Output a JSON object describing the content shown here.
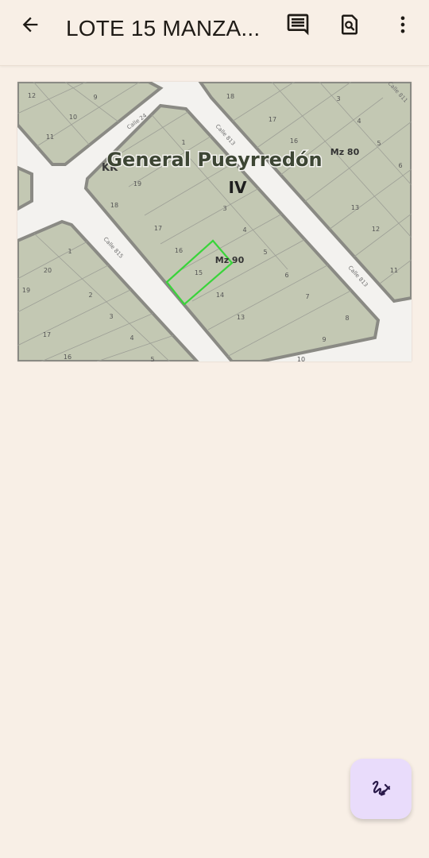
{
  "appbar": {
    "title": "LOTE 15 MANZA...",
    "back_icon": "arrow-back-icon",
    "comment_icon": "comment-icon",
    "find_icon": "find-in-page-icon",
    "more_icon": "more-vert-icon"
  },
  "map": {
    "locality": "General Pueyrredón",
    "section": "IV",
    "block_code": "KK",
    "manzanas": {
      "main": "Mz 90",
      "north": "Mz 80"
    },
    "highlight_color": "#39d43a",
    "streets": [
      "Calle 24",
      "Calle 813",
      "Calle 815",
      "Calle 813",
      "Calle 811"
    ],
    "plots_mz90": [
      "1",
      "19",
      "18",
      "17",
      "16",
      "15",
      "14",
      "13",
      "3",
      "4",
      "5",
      "6",
      "7",
      "8",
      "9",
      "10"
    ],
    "plots_mz80": [
      "18",
      "17",
      "16",
      "3",
      "4",
      "5",
      "6",
      "13",
      "12",
      "11"
    ],
    "plots_left_top": [
      "12",
      "9",
      "10",
      "11"
    ],
    "plots_left_bottom": [
      "1",
      "20",
      "19",
      "2",
      "3",
      "17",
      "4",
      "16",
      "5"
    ],
    "highlighted_plot": "15"
  },
  "fab": {
    "icon": "draw-signature-icon"
  }
}
